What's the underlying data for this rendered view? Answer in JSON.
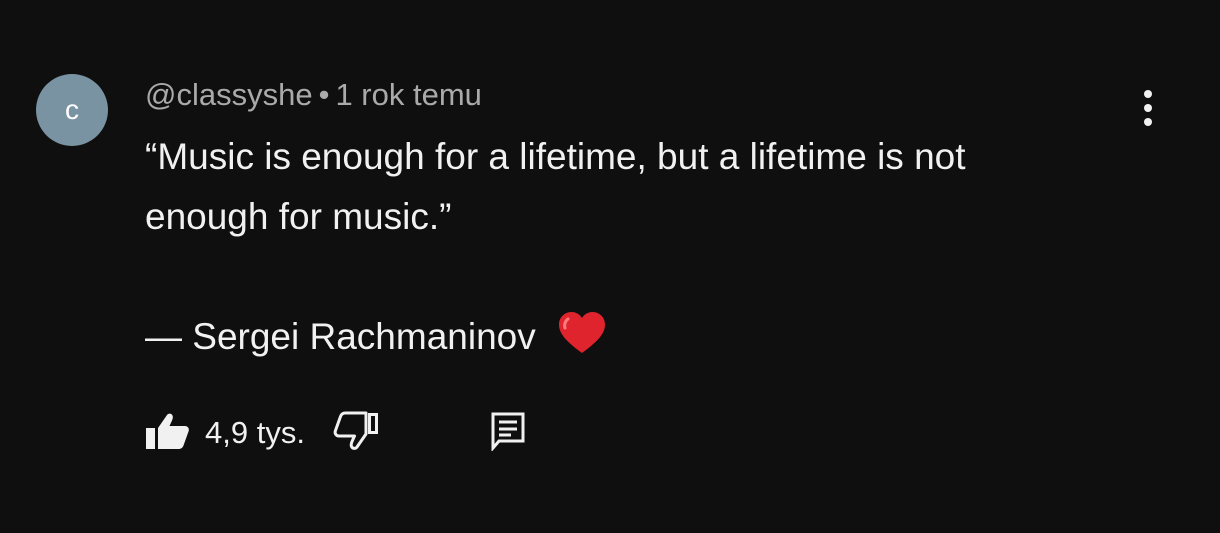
{
  "comment": {
    "avatar_letter": "c",
    "author": "@classyshe",
    "separator": "•",
    "timestamp": "1 rok temu",
    "text_line_1": "“Music is enough for a lifetime, but a lifetime is not",
    "text_line_2": "enough for music.”",
    "text_line_3": "— Sergei Rachmaninov",
    "heart_icon": "red-heart-emoji",
    "like_count": "4,9 tys."
  },
  "icons": {
    "like": "thumbs-up-filled-icon",
    "dislike": "thumbs-down-outline-icon",
    "reply": "reply-comment-icon",
    "more": "vertical-ellipsis-icon"
  },
  "colors": {
    "background": "#0f0f0f",
    "avatar": "#7a93a2",
    "text": "#f1f1f1",
    "meta_text": "#aaaaaa",
    "heart": "#e0242e"
  }
}
